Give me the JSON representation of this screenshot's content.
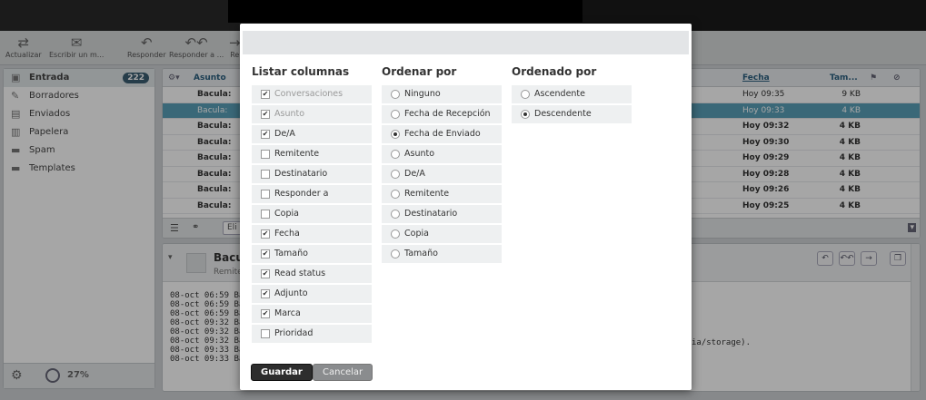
{
  "toolbar": {
    "refresh_label": "Actualizar",
    "compose_label": "Escribir un m...",
    "reply_label": "Responder",
    "reply_all_label": "Responder a ...",
    "forward_label": "Re"
  },
  "search": {
    "scope_glyph": "⇕",
    "search_glyph": "Q▾"
  },
  "folders": [
    {
      "label": "Entrada",
      "count": "222",
      "icon": "inbox-icon"
    },
    {
      "label": "Borradores",
      "icon": "pencil-icon"
    },
    {
      "label": "Enviados",
      "icon": "sent-icon"
    },
    {
      "label": "Papelera",
      "icon": "trash-icon"
    },
    {
      "label": "Spam",
      "icon": "folder-icon"
    },
    {
      "label": "Templates",
      "icon": "folder-icon"
    }
  ],
  "quota": {
    "percent": "27%"
  },
  "list": {
    "subject_header": "Asunto",
    "date_header": "Fecha",
    "size_header": "Tam...",
    "rows": [
      {
        "subject": "Bacula:",
        "date": "Hoy 09:35",
        "size": "9 KB"
      },
      {
        "subject": "Bacula:",
        "date": "Hoy 09:33",
        "size": "4 KB"
      },
      {
        "subject": "Bacula:",
        "date": "Hoy 09:32",
        "size": "4 KB"
      },
      {
        "subject": "Bacula:",
        "date": "Hoy 09:30",
        "size": "4 KB"
      },
      {
        "subject": "Bacula:",
        "date": "Hoy 09:29",
        "size": "4 KB"
      },
      {
        "subject": "Bacula:",
        "date": "Hoy 09:28",
        "size": "4 KB"
      },
      {
        "subject": "Bacula:",
        "date": "Hoy 09:26",
        "size": "4 KB"
      },
      {
        "subject": "Bacula:",
        "date": "Hoy 09:25",
        "size": "4 KB"
      }
    ],
    "select_label": "Eli"
  },
  "preview": {
    "subject": "Bacu",
    "from": "Remite",
    "lines": "08-oct 06:59 Ba\n08-oct 06:59 Ba\n08-oct 06:59 Ba\n08-oct 09:32 Ba\n08-oct 09:32 Ba\n08-oct 09:32 Ba\n08-oct 09:33 Ba\n08-oct 09:33 Ba",
    "tail_text": "ia/storage)."
  },
  "dialog": {
    "columns_title": "Listar columnas",
    "sort_title": "Ordenar por",
    "order_title": "Ordenado por",
    "columns": [
      {
        "label": "Conversaciones",
        "checked": true,
        "disabled": true
      },
      {
        "label": "Asunto",
        "checked": true,
        "disabled": true
      },
      {
        "label": "De/A",
        "checked": true,
        "disabled": false
      },
      {
        "label": "Remitente",
        "checked": false,
        "disabled": false
      },
      {
        "label": "Destinatario",
        "checked": false,
        "disabled": false
      },
      {
        "label": "Responder a",
        "checked": false,
        "disabled": false
      },
      {
        "label": "Copia",
        "checked": false,
        "disabled": false
      },
      {
        "label": "Fecha",
        "checked": true,
        "disabled": false
      },
      {
        "label": "Tamaño",
        "checked": true,
        "disabled": false
      },
      {
        "label": "Read status",
        "checked": true,
        "disabled": false
      },
      {
        "label": "Adjunto",
        "checked": true,
        "disabled": false
      },
      {
        "label": "Marca",
        "checked": true,
        "disabled": false
      },
      {
        "label": "Prioridad",
        "checked": false,
        "disabled": false
      }
    ],
    "sort_options": [
      {
        "label": "Ninguno",
        "selected": false
      },
      {
        "label": "Fecha de Recepción",
        "selected": false
      },
      {
        "label": "Fecha de Enviado",
        "selected": true
      },
      {
        "label": "Asunto",
        "selected": false
      },
      {
        "label": "De/A",
        "selected": false
      },
      {
        "label": "Remitente",
        "selected": false
      },
      {
        "label": "Destinatario",
        "selected": false
      },
      {
        "label": "Copia",
        "selected": false
      },
      {
        "label": "Tamaño",
        "selected": false
      }
    ],
    "order_options": [
      {
        "label": "Ascendente",
        "selected": false
      },
      {
        "label": "Descendente",
        "selected": true
      }
    ],
    "save_label": "Guardar",
    "cancel_label": "Cancelar"
  }
}
